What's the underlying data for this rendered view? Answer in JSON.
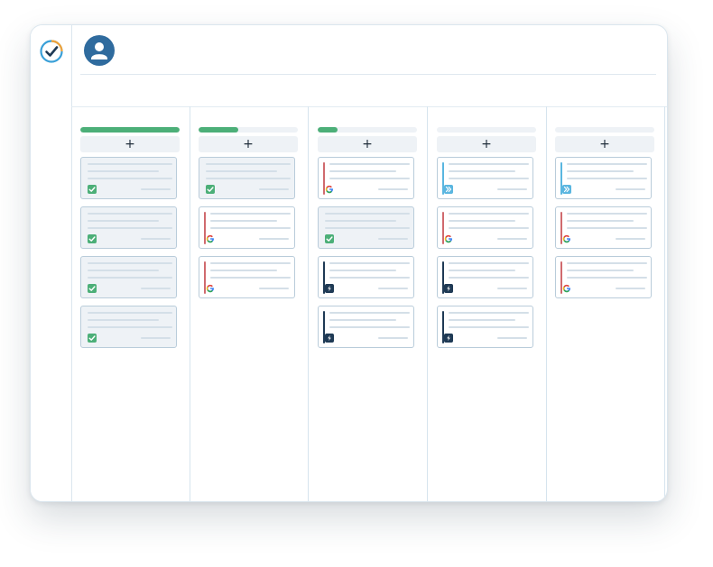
{
  "header": {
    "avatar_icon": "user-icon",
    "logo_icon": "checkmark-circle-logo-icon"
  },
  "colors": {
    "progress_fill": "#4caf78",
    "check_badge": "#4caf78",
    "google_accent": "#d06a6e",
    "forward_badge": "#5ab6e0",
    "bolt_badge": "#1f3a55",
    "avatar": "#2f6b9e"
  },
  "columns": [
    {
      "add_label": "+",
      "progress": 1.0,
      "cards": [
        {
          "type": "done"
        },
        {
          "type": "done"
        },
        {
          "type": "done"
        },
        {
          "type": "done"
        }
      ]
    },
    {
      "add_label": "+",
      "progress": 0.4,
      "cards": [
        {
          "type": "done"
        },
        {
          "type": "google"
        },
        {
          "type": "google"
        }
      ]
    },
    {
      "add_label": "+",
      "progress": 0.2,
      "cards": [
        {
          "type": "google"
        },
        {
          "type": "done"
        },
        {
          "type": "bolt"
        },
        {
          "type": "bolt"
        }
      ]
    },
    {
      "add_label": "+",
      "progress": 0.0,
      "cards": [
        {
          "type": "forward"
        },
        {
          "type": "google"
        },
        {
          "type": "bolt"
        },
        {
          "type": "bolt"
        }
      ]
    },
    {
      "add_label": "+",
      "progress": 0.0,
      "cards": [
        {
          "type": "forward"
        },
        {
          "type": "google"
        },
        {
          "type": "google"
        }
      ]
    }
  ]
}
